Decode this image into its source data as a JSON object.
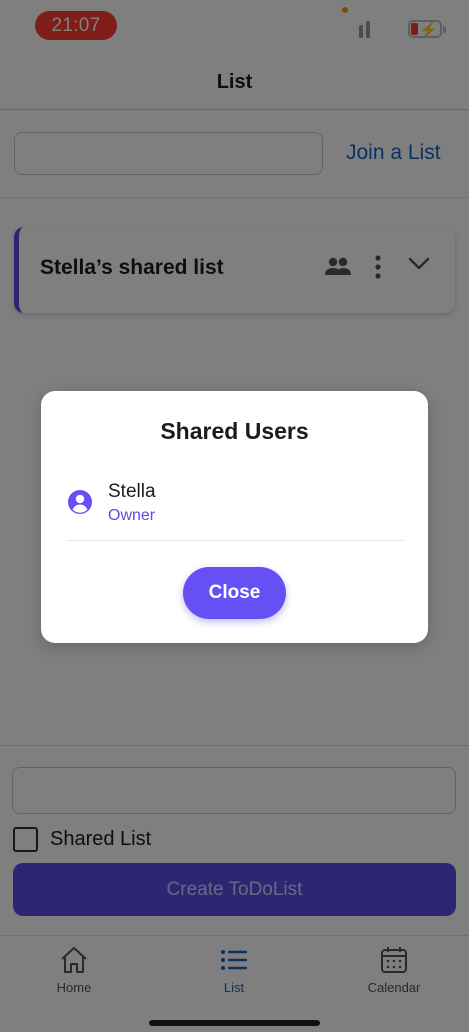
{
  "status_bar": {
    "time": "21:07"
  },
  "header": {
    "title": "List"
  },
  "join": {
    "input_value": "",
    "link_label": "Join a List"
  },
  "lists": [
    {
      "title": "Stella’s shared list",
      "accent": "#5b4ee0"
    }
  ],
  "form": {
    "input_value": "",
    "checkbox_label": "Shared List",
    "checkbox_checked": false,
    "create_label": "Create ToDoList"
  },
  "tabs": [
    {
      "label": "Home",
      "icon": "house-icon",
      "active": false
    },
    {
      "label": "List",
      "icon": "list-icon",
      "active": true
    },
    {
      "label": "Calendar",
      "icon": "calendar-icon",
      "active": false
    }
  ],
  "modal": {
    "title": "Shared Users",
    "users": [
      {
        "name": "Stella",
        "role": "Owner",
        "icon": "user-circle-icon"
      }
    ],
    "close_label": "Close"
  },
  "colors": {
    "accent": "#5b4ee0",
    "link": "#1565c0",
    "close_button": "#6650f5",
    "time_pill": "#ff3b30"
  }
}
